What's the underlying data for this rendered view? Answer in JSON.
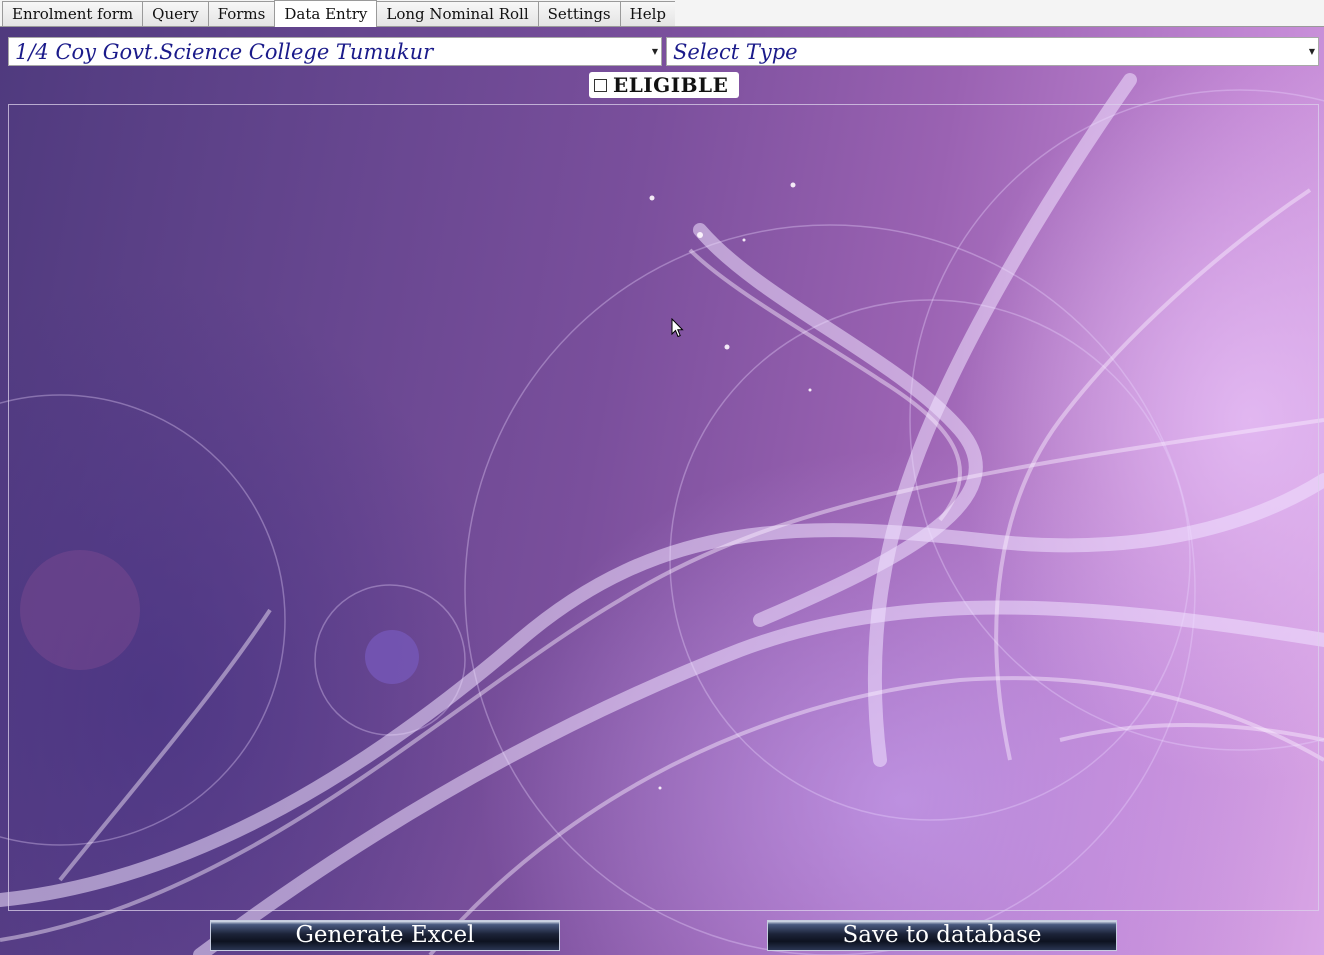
{
  "tabs": [
    {
      "label": "Enrolment form"
    },
    {
      "label": "Query"
    },
    {
      "label": "Forms"
    },
    {
      "label": "Data Entry",
      "active": true
    },
    {
      "label": "Long Nominal Roll"
    },
    {
      "label": "Settings"
    },
    {
      "label": "Help"
    }
  ],
  "unit_select": {
    "value": "1/4 Coy Govt.Science College Tumukur"
  },
  "type_select": {
    "value": "Select Type"
  },
  "eligible": {
    "label": "ELIGIBLE",
    "checked": false
  },
  "buttons": {
    "generate_excel": "Generate Excel",
    "save_to_database": "Save to database"
  },
  "colors": {
    "select_text": "#1a1a8a",
    "button_dark": "#0d1220",
    "background_purple": "#7a4f9c"
  }
}
